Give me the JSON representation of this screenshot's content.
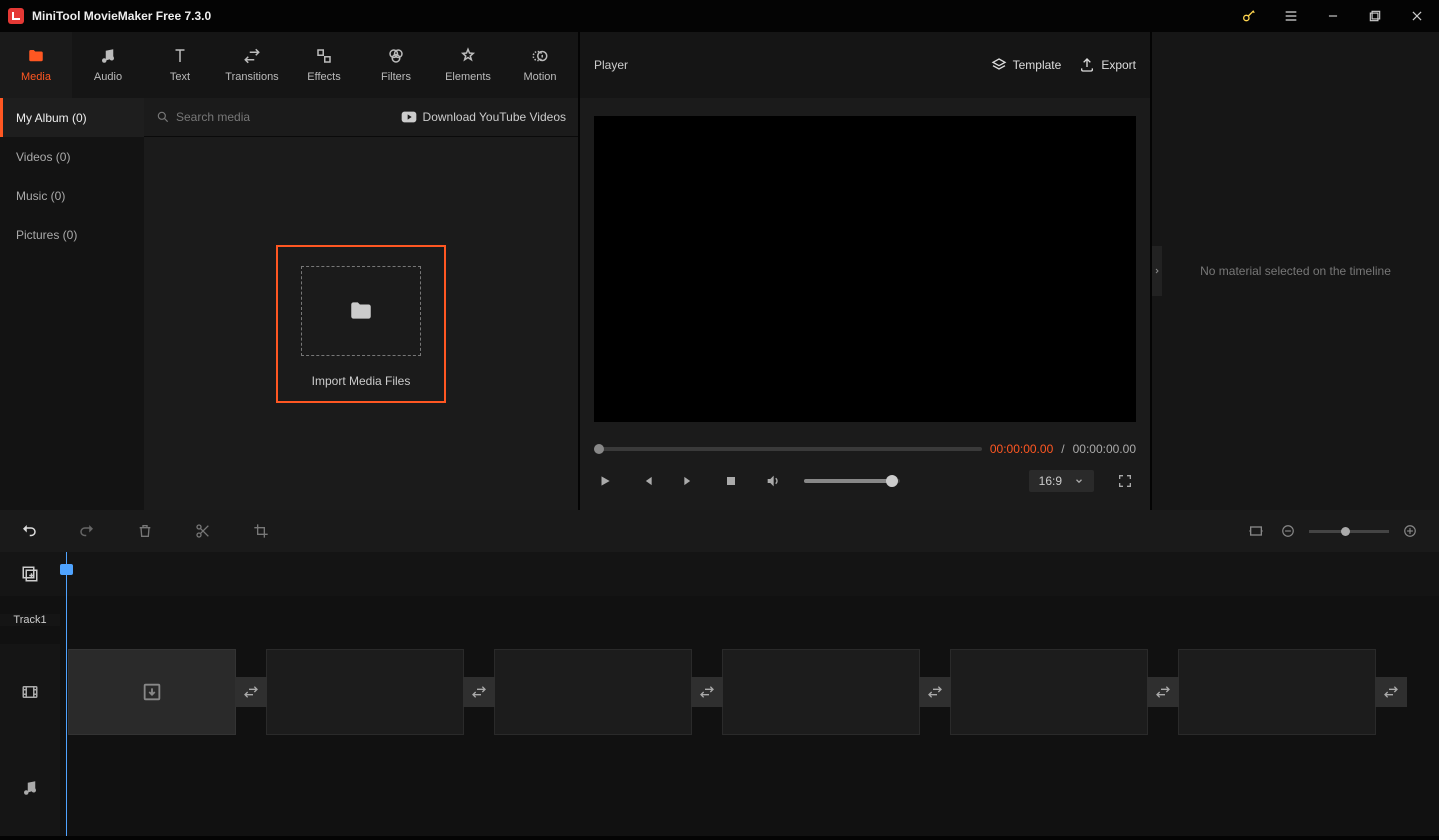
{
  "app": {
    "title": "MiniTool MovieMaker Free 7.3.0"
  },
  "ribbon": {
    "tabs": [
      {
        "label": "Media"
      },
      {
        "label": "Audio"
      },
      {
        "label": "Text"
      },
      {
        "label": "Transitions"
      },
      {
        "label": "Effects"
      },
      {
        "label": "Filters"
      },
      {
        "label": "Elements"
      },
      {
        "label": "Motion"
      }
    ]
  },
  "sidebar": {
    "items": [
      {
        "label": "My Album (0)"
      },
      {
        "label": "Videos (0)"
      },
      {
        "label": "Music (0)"
      },
      {
        "label": "Pictures (0)"
      }
    ]
  },
  "media": {
    "search_placeholder": "Search media",
    "download_label": "Download YouTube Videos",
    "import_label": "Import Media Files"
  },
  "player": {
    "title": "Player",
    "template_label": "Template",
    "export_label": "Export",
    "time_current": "00:00:00.00",
    "time_separator": "/",
    "time_total": "00:00:00.00",
    "aspect": "16:9"
  },
  "properties": {
    "empty_text": "No material selected on the timeline"
  },
  "timeline": {
    "track_label": "Track1"
  }
}
